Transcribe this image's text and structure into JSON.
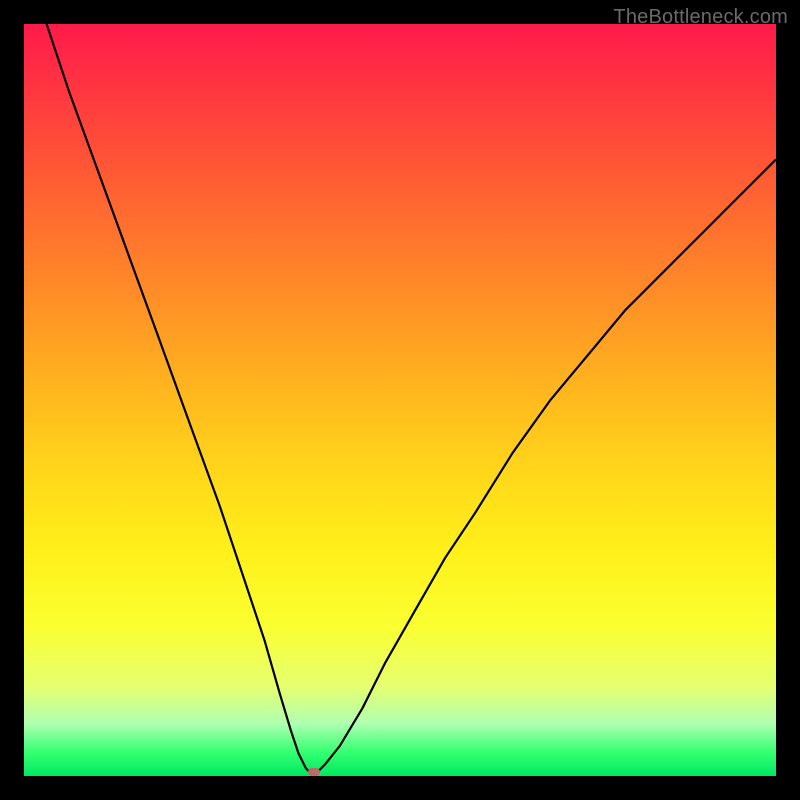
{
  "watermark": "TheBottleneck.com",
  "chart_data": {
    "type": "line",
    "title": "",
    "xlabel": "",
    "ylabel": "",
    "xlim": [
      0,
      100
    ],
    "ylim": [
      0,
      100
    ],
    "grid": false,
    "series": [
      {
        "name": "bottleneck-curve",
        "x": [
          3,
          6,
          10,
          14,
          18,
          22,
          26,
          29,
          32,
          34,
          35.5,
          36.5,
          37.5,
          38,
          39,
          40,
          42,
          45,
          48,
          52,
          56,
          60,
          65,
          70,
          75,
          80,
          85,
          90,
          95,
          100
        ],
        "values": [
          100,
          91,
          80,
          69,
          58,
          47,
          36,
          27,
          18,
          11,
          6,
          3,
          1,
          0.5,
          0.5,
          1.5,
          4,
          9,
          15,
          22,
          29,
          35,
          43,
          50,
          56,
          62,
          67,
          72,
          77,
          82
        ]
      }
    ],
    "marker": {
      "x": 38.5,
      "y": 0.5
    },
    "gradient_stops": [
      {
        "pos": 0,
        "color": "#ff1a4b"
      },
      {
        "pos": 10,
        "color": "#ff3a3f"
      },
      {
        "pos": 20,
        "color": "#ff5a34"
      },
      {
        "pos": 30,
        "color": "#ff7a2c"
      },
      {
        "pos": 40,
        "color": "#ff9a24"
      },
      {
        "pos": 50,
        "color": "#ffba1e"
      },
      {
        "pos": 60,
        "color": "#ffd81a"
      },
      {
        "pos": 70,
        "color": "#fff01a"
      },
      {
        "pos": 80,
        "color": "#faff30"
      },
      {
        "pos": 88,
        "color": "#e6ff70"
      },
      {
        "pos": 93,
        "color": "#b0ffb0"
      },
      {
        "pos": 97,
        "color": "#30ff70"
      },
      {
        "pos": 100,
        "color": "#00e860"
      }
    ]
  }
}
